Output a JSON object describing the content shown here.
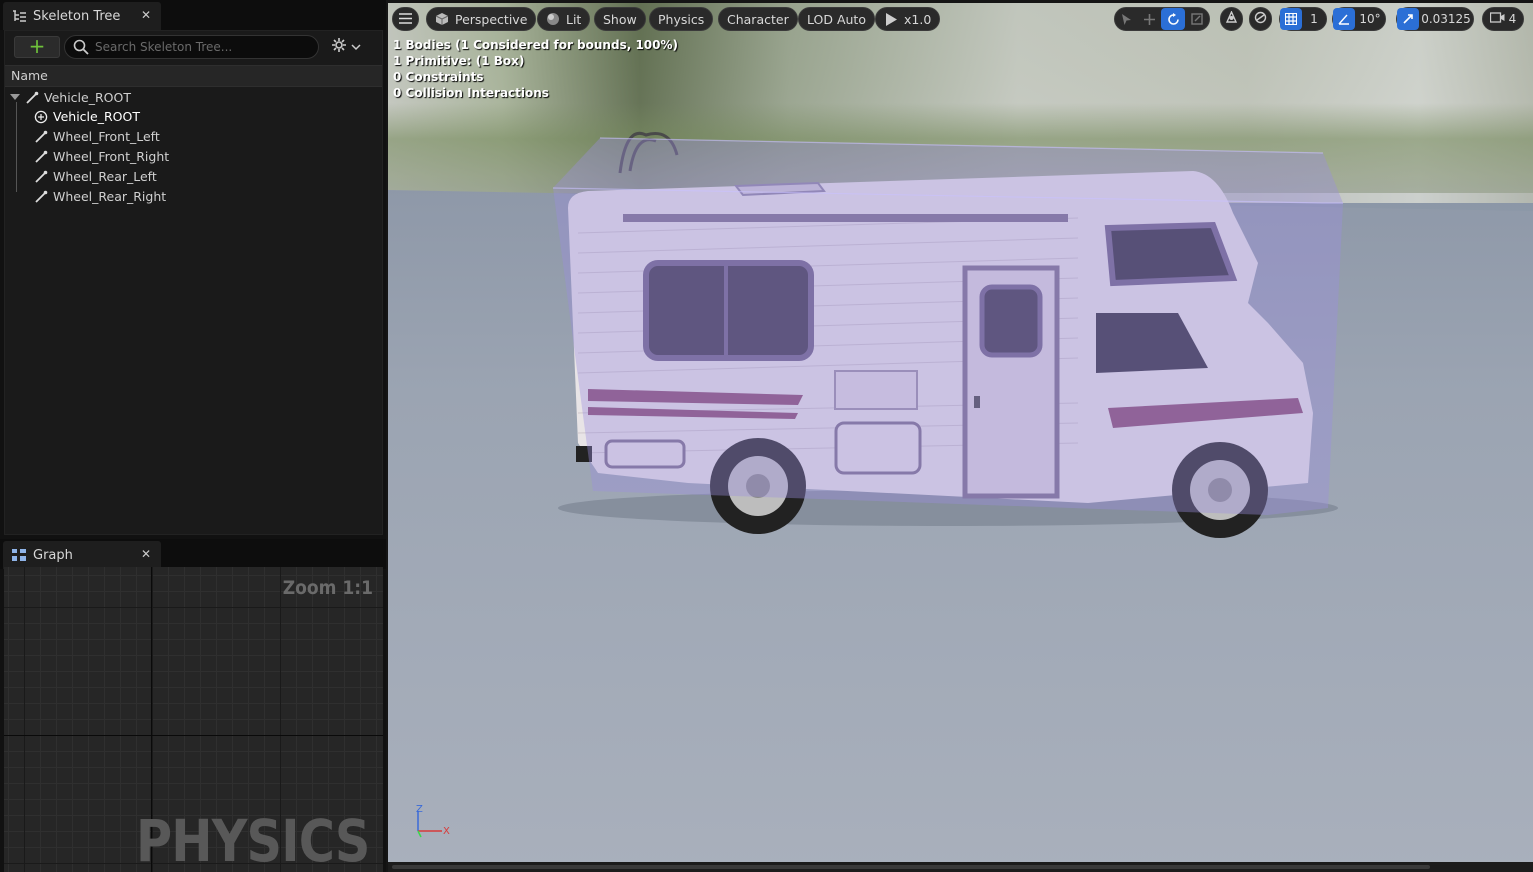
{
  "skeleton_tree": {
    "tab_label": "Skeleton Tree",
    "add_label": "+",
    "search_placeholder": "Search Skeleton Tree...",
    "column_name": "Name",
    "items": [
      {
        "label": "Vehicle_ROOT",
        "icon": "bone-icon"
      },
      {
        "label": "Vehicle_ROOT",
        "icon": "body-icon"
      },
      {
        "label": "Wheel_Front_Left",
        "icon": "bone-icon"
      },
      {
        "label": "Wheel_Front_Right",
        "icon": "bone-icon"
      },
      {
        "label": "Wheel_Rear_Left",
        "icon": "bone-icon"
      },
      {
        "label": "Wheel_Rear_Right",
        "icon": "bone-icon"
      }
    ]
  },
  "graph": {
    "tab_label": "Graph",
    "zoom": "Zoom 1:1",
    "watermark": "PHYSICS"
  },
  "viewport": {
    "toolbar": {
      "perspective": "Perspective",
      "lit": "Lit",
      "show": "Show",
      "physics": "Physics",
      "character": "Character",
      "lod": "LOD Auto",
      "play_speed": "x1.0",
      "grid_size": "1",
      "rotation_snap": "10°",
      "scale_snap": "0.03125",
      "camera_speed": "4"
    },
    "stats": [
      "1 Bodies (1 Considered for bounds, 100%)",
      "1 Primitive: (1 Box)",
      "0 Constraints",
      "0 Collision Interactions"
    ],
    "axis_labels": {
      "z": "Z",
      "x": "X"
    }
  },
  "colors": {
    "accent_blue": "#2b6fd6",
    "add_green": "#6fc23b",
    "collision_box": "#9a8fe0"
  }
}
